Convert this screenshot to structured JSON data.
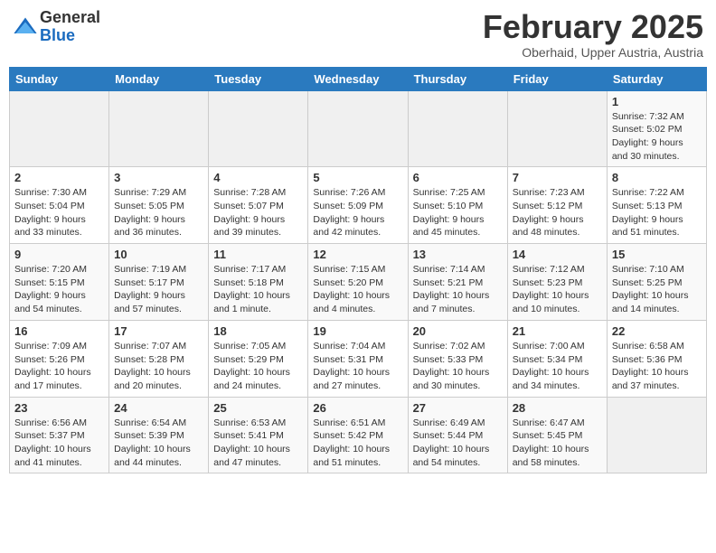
{
  "logo": {
    "general": "General",
    "blue": "Blue"
  },
  "header": {
    "month": "February 2025",
    "location": "Oberhaid, Upper Austria, Austria"
  },
  "days_of_week": [
    "Sunday",
    "Monday",
    "Tuesday",
    "Wednesday",
    "Thursday",
    "Friday",
    "Saturday"
  ],
  "weeks": [
    [
      {
        "day": "",
        "info": ""
      },
      {
        "day": "",
        "info": ""
      },
      {
        "day": "",
        "info": ""
      },
      {
        "day": "",
        "info": ""
      },
      {
        "day": "",
        "info": ""
      },
      {
        "day": "",
        "info": ""
      },
      {
        "day": "1",
        "info": "Sunrise: 7:32 AM\nSunset: 5:02 PM\nDaylight: 9 hours and 30 minutes."
      }
    ],
    [
      {
        "day": "2",
        "info": "Sunrise: 7:30 AM\nSunset: 5:04 PM\nDaylight: 9 hours and 33 minutes."
      },
      {
        "day": "3",
        "info": "Sunrise: 7:29 AM\nSunset: 5:05 PM\nDaylight: 9 hours and 36 minutes."
      },
      {
        "day": "4",
        "info": "Sunrise: 7:28 AM\nSunset: 5:07 PM\nDaylight: 9 hours and 39 minutes."
      },
      {
        "day": "5",
        "info": "Sunrise: 7:26 AM\nSunset: 5:09 PM\nDaylight: 9 hours and 42 minutes."
      },
      {
        "day": "6",
        "info": "Sunrise: 7:25 AM\nSunset: 5:10 PM\nDaylight: 9 hours and 45 minutes."
      },
      {
        "day": "7",
        "info": "Sunrise: 7:23 AM\nSunset: 5:12 PM\nDaylight: 9 hours and 48 minutes."
      },
      {
        "day": "8",
        "info": "Sunrise: 7:22 AM\nSunset: 5:13 PM\nDaylight: 9 hours and 51 minutes."
      }
    ],
    [
      {
        "day": "9",
        "info": "Sunrise: 7:20 AM\nSunset: 5:15 PM\nDaylight: 9 hours and 54 minutes."
      },
      {
        "day": "10",
        "info": "Sunrise: 7:19 AM\nSunset: 5:17 PM\nDaylight: 9 hours and 57 minutes."
      },
      {
        "day": "11",
        "info": "Sunrise: 7:17 AM\nSunset: 5:18 PM\nDaylight: 10 hours and 1 minute."
      },
      {
        "day": "12",
        "info": "Sunrise: 7:15 AM\nSunset: 5:20 PM\nDaylight: 10 hours and 4 minutes."
      },
      {
        "day": "13",
        "info": "Sunrise: 7:14 AM\nSunset: 5:21 PM\nDaylight: 10 hours and 7 minutes."
      },
      {
        "day": "14",
        "info": "Sunrise: 7:12 AM\nSunset: 5:23 PM\nDaylight: 10 hours and 10 minutes."
      },
      {
        "day": "15",
        "info": "Sunrise: 7:10 AM\nSunset: 5:25 PM\nDaylight: 10 hours and 14 minutes."
      }
    ],
    [
      {
        "day": "16",
        "info": "Sunrise: 7:09 AM\nSunset: 5:26 PM\nDaylight: 10 hours and 17 minutes."
      },
      {
        "day": "17",
        "info": "Sunrise: 7:07 AM\nSunset: 5:28 PM\nDaylight: 10 hours and 20 minutes."
      },
      {
        "day": "18",
        "info": "Sunrise: 7:05 AM\nSunset: 5:29 PM\nDaylight: 10 hours and 24 minutes."
      },
      {
        "day": "19",
        "info": "Sunrise: 7:04 AM\nSunset: 5:31 PM\nDaylight: 10 hours and 27 minutes."
      },
      {
        "day": "20",
        "info": "Sunrise: 7:02 AM\nSunset: 5:33 PM\nDaylight: 10 hours and 30 minutes."
      },
      {
        "day": "21",
        "info": "Sunrise: 7:00 AM\nSunset: 5:34 PM\nDaylight: 10 hours and 34 minutes."
      },
      {
        "day": "22",
        "info": "Sunrise: 6:58 AM\nSunset: 5:36 PM\nDaylight: 10 hours and 37 minutes."
      }
    ],
    [
      {
        "day": "23",
        "info": "Sunrise: 6:56 AM\nSunset: 5:37 PM\nDaylight: 10 hours and 41 minutes."
      },
      {
        "day": "24",
        "info": "Sunrise: 6:54 AM\nSunset: 5:39 PM\nDaylight: 10 hours and 44 minutes."
      },
      {
        "day": "25",
        "info": "Sunrise: 6:53 AM\nSunset: 5:41 PM\nDaylight: 10 hours and 47 minutes."
      },
      {
        "day": "26",
        "info": "Sunrise: 6:51 AM\nSunset: 5:42 PM\nDaylight: 10 hours and 51 minutes."
      },
      {
        "day": "27",
        "info": "Sunrise: 6:49 AM\nSunset: 5:44 PM\nDaylight: 10 hours and 54 minutes."
      },
      {
        "day": "28",
        "info": "Sunrise: 6:47 AM\nSunset: 5:45 PM\nDaylight: 10 hours and 58 minutes."
      },
      {
        "day": "",
        "info": ""
      }
    ]
  ]
}
